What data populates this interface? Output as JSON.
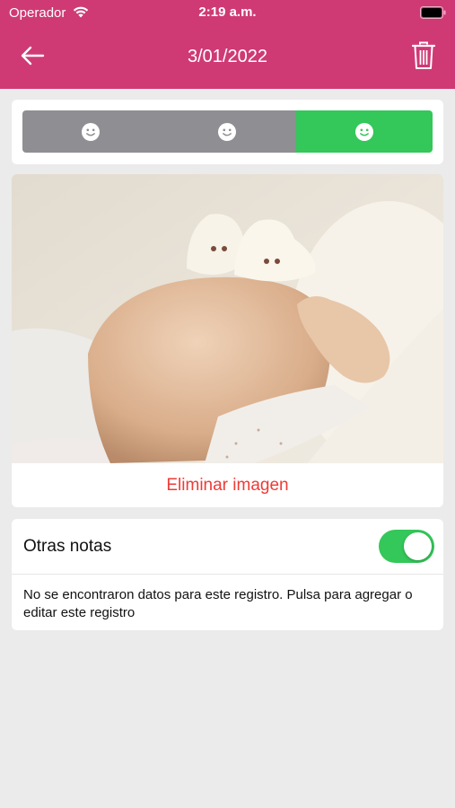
{
  "status_bar": {
    "carrier": "Operador",
    "time": "2:19 a.m."
  },
  "nav": {
    "title": "3/01/2022",
    "back_icon": "arrow-left-icon",
    "delete_icon": "trash-icon"
  },
  "mood": {
    "options": [
      "smiley-face-icon",
      "smiley-face-icon",
      "smiley-face-icon"
    ],
    "selected_index": 2
  },
  "image": {
    "delete_label": "Eliminar imagen"
  },
  "notes": {
    "title": "Otras notas",
    "toggle_on": true,
    "body": "No se encontraron datos para este registro. Pulsa para agregar o editar este registro"
  },
  "colors": {
    "header": "#cf3a75",
    "accent_green": "#34c759",
    "mood_unselected": "#8e8e93",
    "danger": "#ef3b36"
  }
}
